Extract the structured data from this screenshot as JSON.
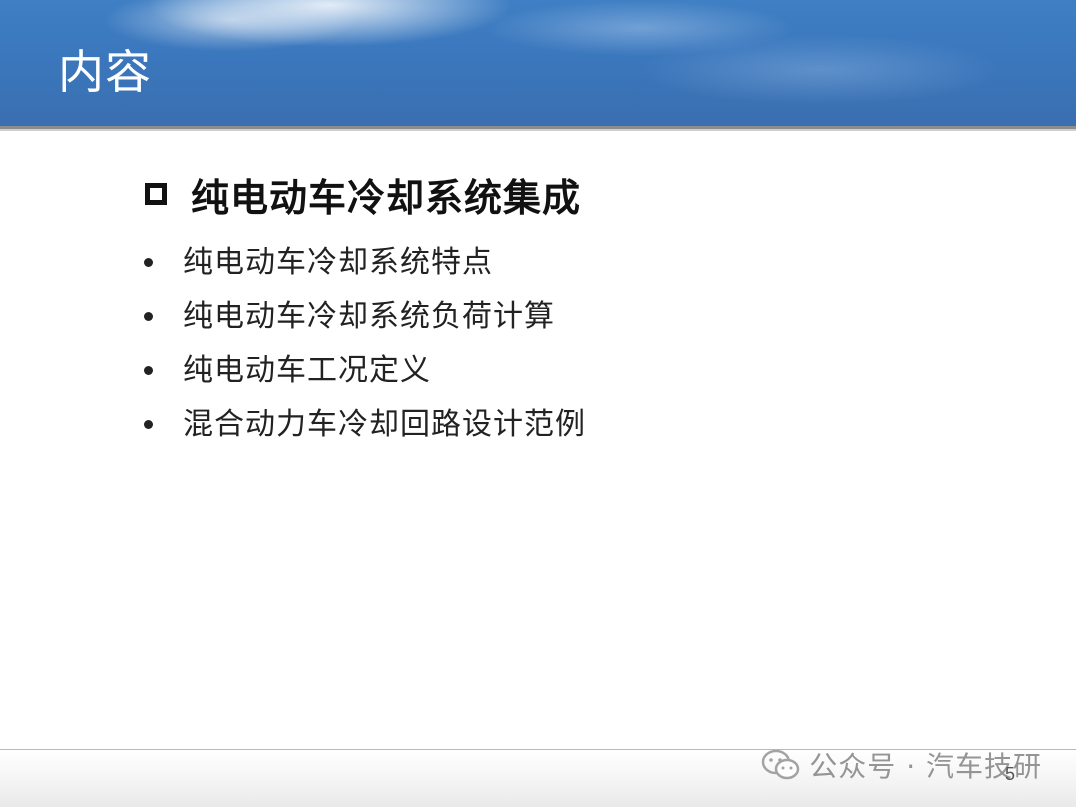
{
  "header": {
    "title": "内容"
  },
  "section": {
    "title": "纯电动车冷却系统集成",
    "icon": "hollow-square-icon"
  },
  "bullets": [
    {
      "text": "纯电动车冷却系统特点"
    },
    {
      "text": "纯电动车冷却系统负荷计算"
    },
    {
      "text": "纯电动车工况定义"
    },
    {
      "text": "混合动力车冷却回路设计范例"
    }
  ],
  "footer": {
    "watermark": "公众号 · 汽车技研",
    "watermark_icon": "wechat-icon",
    "page_number": "5"
  },
  "colors": {
    "header_blue": "#3b77bd",
    "title_text": "#ffffff",
    "body_text": "#222222",
    "watermark_gray": "#8a8a8a"
  }
}
